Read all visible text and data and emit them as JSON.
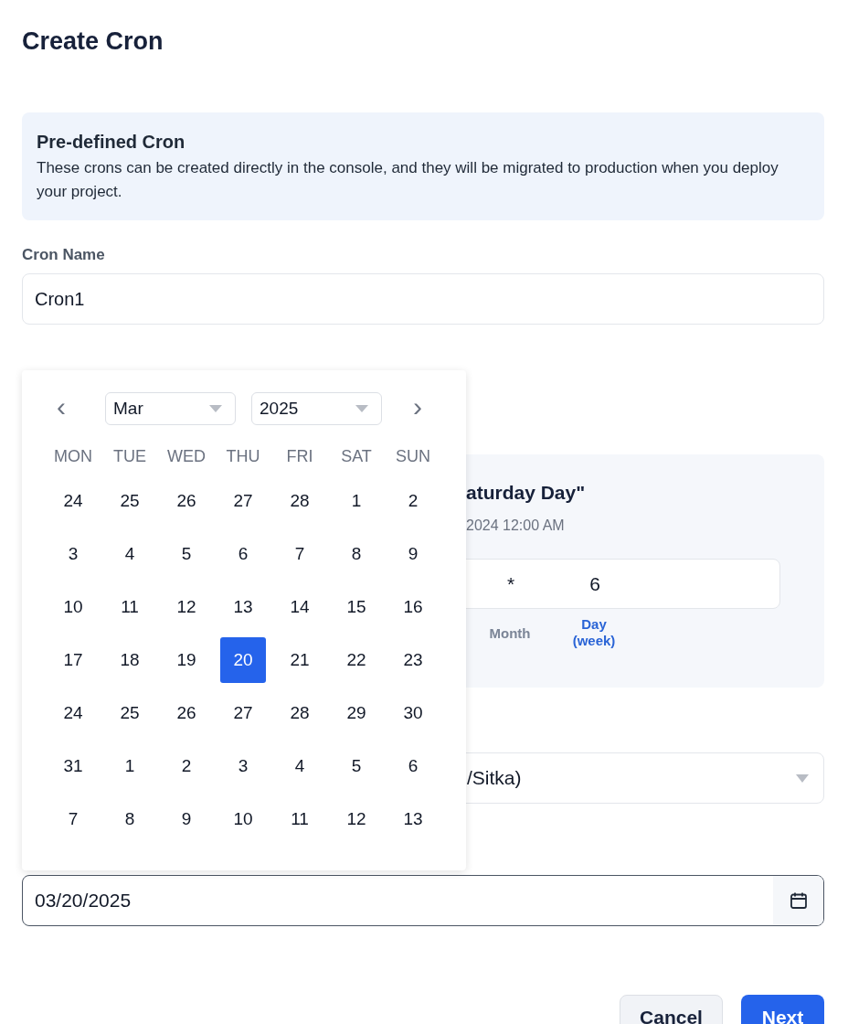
{
  "title": "Create Cron",
  "info": {
    "heading": "Pre-defined Cron",
    "text": "These crons can be created directly in the console, and they will be migrated to production when you deploy your project."
  },
  "cron_name": {
    "label": "Cron Name",
    "value": "Cron1"
  },
  "preview": {
    "title": "aturday Day\"",
    "subtitle": "2024 12:00 AM",
    "fields": [
      {
        "value": "*",
        "label": "Month",
        "selected": false
      },
      {
        "value": "6",
        "label": "Day\n(week)",
        "selected": true
      }
    ]
  },
  "timezone": {
    "value": "/Sitka)"
  },
  "date": {
    "value": "03/20/2025"
  },
  "datepicker": {
    "prev": "‹",
    "next": "›",
    "month": "Mar",
    "year": "2025",
    "weekdays": [
      "MON",
      "TUE",
      "WED",
      "THU",
      "FRI",
      "SAT",
      "SUN"
    ],
    "weeks": [
      [
        {
          "label": "24",
          "selected": false
        },
        {
          "label": "25",
          "selected": false
        },
        {
          "label": "26",
          "selected": false
        },
        {
          "label": "27",
          "selected": false
        },
        {
          "label": "28",
          "selected": false
        },
        {
          "label": "1",
          "selected": false
        },
        {
          "label": "2",
          "selected": false
        }
      ],
      [
        {
          "label": "3",
          "selected": false
        },
        {
          "label": "4",
          "selected": false
        },
        {
          "label": "5",
          "selected": false
        },
        {
          "label": "6",
          "selected": false
        },
        {
          "label": "7",
          "selected": false
        },
        {
          "label": "8",
          "selected": false
        },
        {
          "label": "9",
          "selected": false
        }
      ],
      [
        {
          "label": "10",
          "selected": false
        },
        {
          "label": "11",
          "selected": false
        },
        {
          "label": "12",
          "selected": false
        },
        {
          "label": "13",
          "selected": false
        },
        {
          "label": "14",
          "selected": false
        },
        {
          "label": "15",
          "selected": false
        },
        {
          "label": "16",
          "selected": false
        }
      ],
      [
        {
          "label": "17",
          "selected": false
        },
        {
          "label": "18",
          "selected": false
        },
        {
          "label": "19",
          "selected": false
        },
        {
          "label": "20",
          "selected": true
        },
        {
          "label": "21",
          "selected": false
        },
        {
          "label": "22",
          "selected": false
        },
        {
          "label": "23",
          "selected": false
        }
      ],
      [
        {
          "label": "24",
          "selected": false
        },
        {
          "label": "25",
          "selected": false
        },
        {
          "label": "26",
          "selected": false
        },
        {
          "label": "27",
          "selected": false
        },
        {
          "label": "28",
          "selected": false
        },
        {
          "label": "29",
          "selected": false
        },
        {
          "label": "30",
          "selected": false
        }
      ],
      [
        {
          "label": "31",
          "selected": false
        },
        {
          "label": "1",
          "selected": false
        },
        {
          "label": "2",
          "selected": false
        },
        {
          "label": "3",
          "selected": false
        },
        {
          "label": "4",
          "selected": false
        },
        {
          "label": "5",
          "selected": false
        },
        {
          "label": "6",
          "selected": false
        }
      ],
      [
        {
          "label": "7",
          "selected": false
        },
        {
          "label": "8",
          "selected": false
        },
        {
          "label": "9",
          "selected": false
        },
        {
          "label": "10",
          "selected": false
        },
        {
          "label": "11",
          "selected": false
        },
        {
          "label": "12",
          "selected": false
        },
        {
          "label": "13",
          "selected": false
        }
      ]
    ]
  },
  "buttons": [
    {
      "label": "Cancel",
      "kind": "secondary"
    },
    {
      "label": "Next",
      "kind": "primary"
    }
  ]
}
